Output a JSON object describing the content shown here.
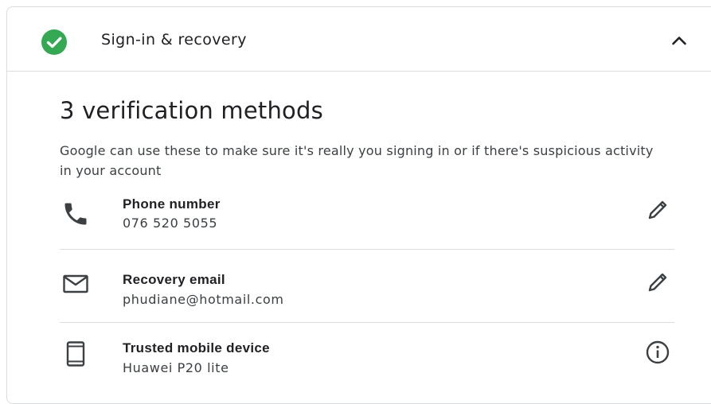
{
  "header": {
    "title": "Sign-in & recovery",
    "status_icon": "check-circle-icon",
    "status_color": "#34a853",
    "collapse_icon": "chevron-up-icon"
  },
  "section": {
    "title": "3 verification methods",
    "description": "Google can use these to make sure it's really you signing in or if there's suspicious activity in your account"
  },
  "methods": [
    {
      "icon": "phone-icon",
      "label": "Phone number",
      "value": "076 520 5055",
      "action_icon": "pencil-icon"
    },
    {
      "icon": "mail-icon",
      "label": "Recovery email",
      "value": "phudiane@hotmail.com",
      "action_icon": "pencil-icon"
    },
    {
      "icon": "mobile-device-icon",
      "label": "Trusted mobile device",
      "value": "Huawei P20 lite",
      "action_icon": "info-icon"
    }
  ]
}
